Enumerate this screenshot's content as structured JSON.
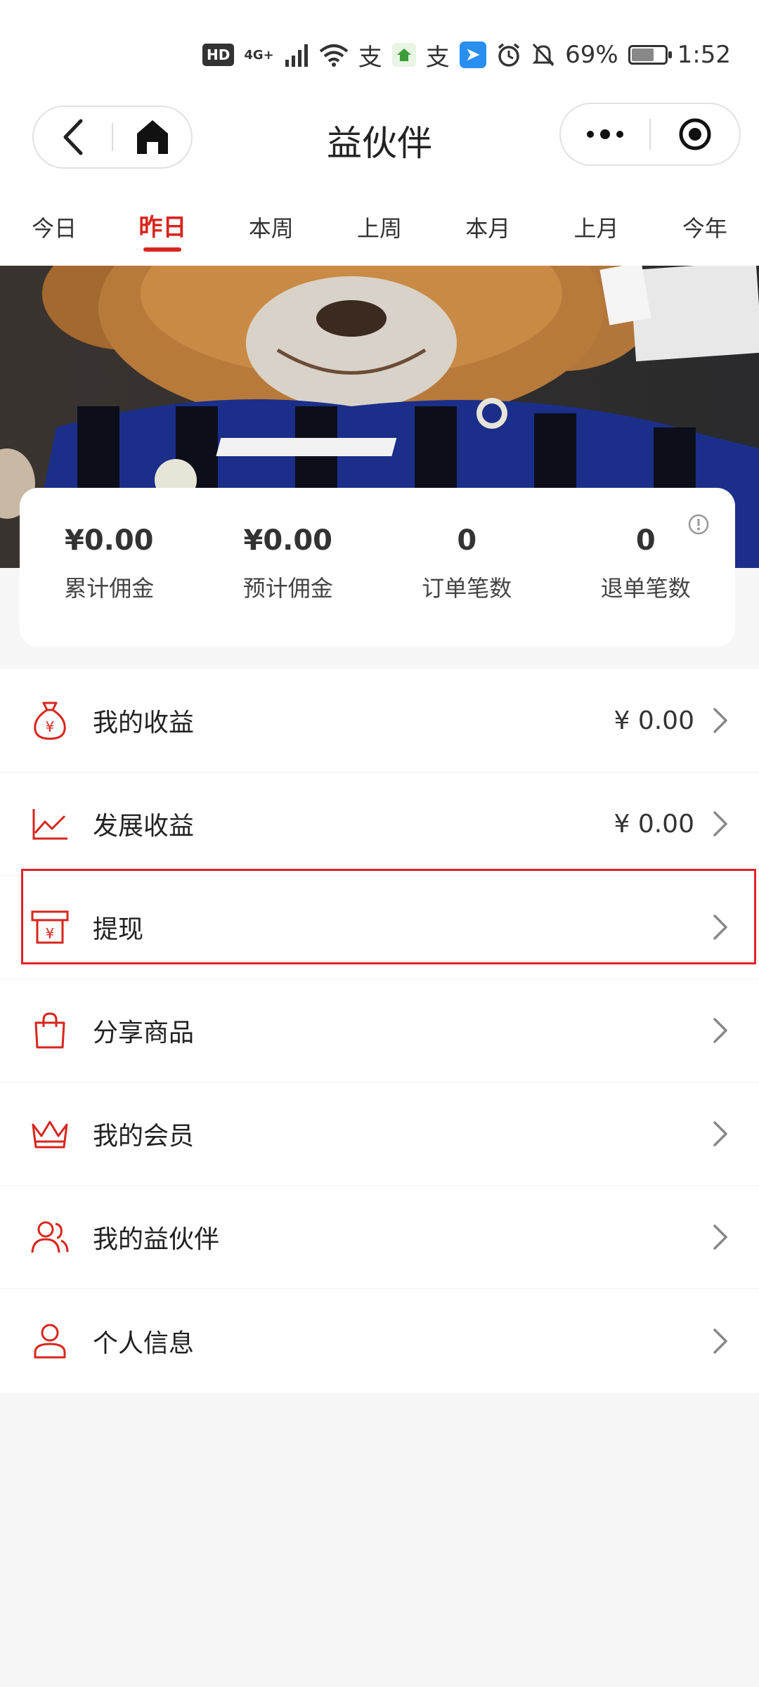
{
  "status_bar": {
    "hd": "HD",
    "signal_type": "4G+",
    "battery_pct": "69%",
    "time": "1:52"
  },
  "header": {
    "title": "益伙伴"
  },
  "tabs": [
    {
      "label": "今日",
      "active": false
    },
    {
      "label": "昨日",
      "active": true
    },
    {
      "label": "本周",
      "active": false
    },
    {
      "label": "上周",
      "active": false
    },
    {
      "label": "本月",
      "active": false
    },
    {
      "label": "上月",
      "active": false
    },
    {
      "label": "今年",
      "active": false
    }
  ],
  "stats": [
    {
      "value": "¥0.00",
      "label": "累计佣金"
    },
    {
      "value": "¥0.00",
      "label": "预计佣金"
    },
    {
      "value": "0",
      "label": "订单笔数"
    },
    {
      "value": "0",
      "label": "退单笔数"
    }
  ],
  "menu": [
    {
      "label": "我的收益",
      "value": "¥ 0.00",
      "icon": "money-bag-icon"
    },
    {
      "label": "发展收益",
      "value": "¥ 0.00",
      "icon": "line-chart-icon"
    },
    {
      "label": "提现",
      "value": "",
      "icon": "withdraw-icon"
    },
    {
      "label": "分享商品",
      "value": "",
      "icon": "shopping-bag-icon"
    },
    {
      "label": "我的会员",
      "value": "",
      "icon": "crown-icon"
    },
    {
      "label": "我的益伙伴",
      "value": "",
      "icon": "users-icon"
    },
    {
      "label": "个人信息",
      "value": "",
      "icon": "user-icon"
    }
  ],
  "colors": {
    "accent": "#d7261d",
    "highlight_border": "#e0242b"
  }
}
